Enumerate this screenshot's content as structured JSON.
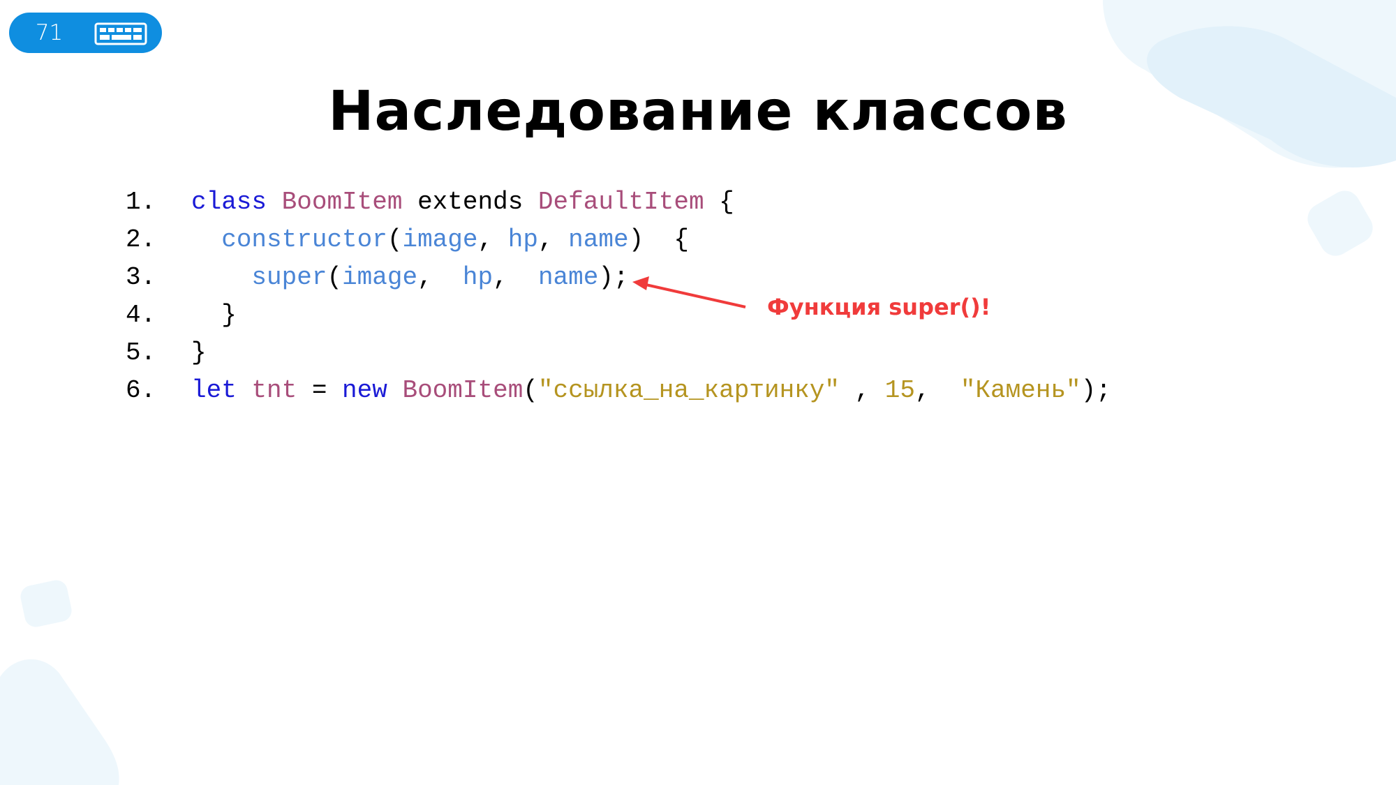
{
  "slide": {
    "number": "71",
    "title": "Наследование классов"
  },
  "colors": {
    "accent": "#0f8ee0",
    "keyword": "#1a1ad6",
    "classname": "#a84d7a",
    "param": "#4a85d6",
    "string": "#b59420",
    "plain": "#000000",
    "annotation": "#f03b3b",
    "decor": "#e4f3fb"
  },
  "icons": {
    "badge": "keyboard-icon"
  },
  "code": {
    "lines": [
      {
        "number": "1.",
        "tokens": [
          {
            "text": "class",
            "type": "keyword"
          },
          {
            "text": " ",
            "type": "plain"
          },
          {
            "text": "BoomItem",
            "type": "classname"
          },
          {
            "text": " extends ",
            "type": "plain"
          },
          {
            "text": "DefaultItem",
            "type": "classname"
          },
          {
            "text": " {",
            "type": "plain"
          }
        ]
      },
      {
        "number": "2.",
        "tokens": [
          {
            "text": "  ",
            "type": "plain"
          },
          {
            "text": "constructor",
            "type": "param"
          },
          {
            "text": "(",
            "type": "plain"
          },
          {
            "text": "image",
            "type": "param"
          },
          {
            "text": ", ",
            "type": "plain"
          },
          {
            "text": "hp",
            "type": "param"
          },
          {
            "text": ", ",
            "type": "plain"
          },
          {
            "text": "name",
            "type": "param"
          },
          {
            "text": ")  {",
            "type": "plain"
          }
        ]
      },
      {
        "number": "3.",
        "tokens": [
          {
            "text": "    ",
            "type": "plain"
          },
          {
            "text": "super",
            "type": "param"
          },
          {
            "text": "(",
            "type": "plain"
          },
          {
            "text": "image",
            "type": "param"
          },
          {
            "text": ",  ",
            "type": "plain"
          },
          {
            "text": "hp",
            "type": "param"
          },
          {
            "text": ",  ",
            "type": "plain"
          },
          {
            "text": "name",
            "type": "param"
          },
          {
            "text": ");",
            "type": "plain"
          }
        ]
      },
      {
        "number": "4.",
        "tokens": [
          {
            "text": "  }",
            "type": "plain"
          }
        ]
      },
      {
        "number": "5.",
        "tokens": [
          {
            "text": "}",
            "type": "plain"
          }
        ]
      },
      {
        "number": "6.",
        "tokens": [
          {
            "text": "let",
            "type": "keyword"
          },
          {
            "text": " ",
            "type": "plain"
          },
          {
            "text": "tnt",
            "type": "classname"
          },
          {
            "text": " = ",
            "type": "plain"
          },
          {
            "text": "new",
            "type": "keyword"
          },
          {
            "text": " ",
            "type": "plain"
          },
          {
            "text": "BoomItem",
            "type": "classname"
          },
          {
            "text": "(",
            "type": "plain"
          },
          {
            "text": "\"ссылка_на_картинку\"",
            "type": "string"
          },
          {
            "text": " , ",
            "type": "plain"
          },
          {
            "text": "15",
            "type": "string"
          },
          {
            "text": ",  ",
            "type": "plain"
          },
          {
            "text": "\"Камень\"",
            "type": "string"
          },
          {
            "text": ");",
            "type": "plain"
          }
        ]
      }
    ]
  },
  "annotation": {
    "text": "Функция super()!"
  }
}
